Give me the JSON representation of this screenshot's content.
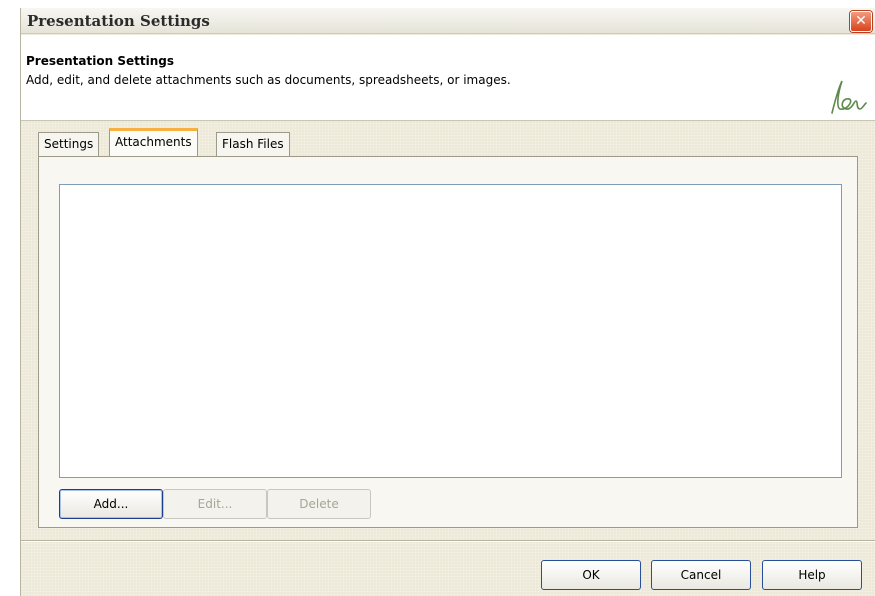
{
  "window": {
    "title": "Presentation Settings",
    "close_label": "✕"
  },
  "header": {
    "title": "Presentation Settings",
    "description": "Add, edit, and delete attachments such as documents, spreadsheets, or images."
  },
  "tabs": [
    {
      "label": "Settings",
      "active": false
    },
    {
      "label": "Attachments",
      "active": true
    },
    {
      "label": "Flash Files",
      "active": false
    }
  ],
  "attachments": {
    "items": [],
    "buttons": {
      "add": "Add...",
      "edit": "Edit...",
      "delete": "Delete"
    }
  },
  "footer": {
    "ok": "OK",
    "cancel": "Cancel",
    "help": "Help"
  },
  "colors": {
    "accent_tab": "#f5b041",
    "logo": "#5c8a4a",
    "close": "#d9431c"
  }
}
